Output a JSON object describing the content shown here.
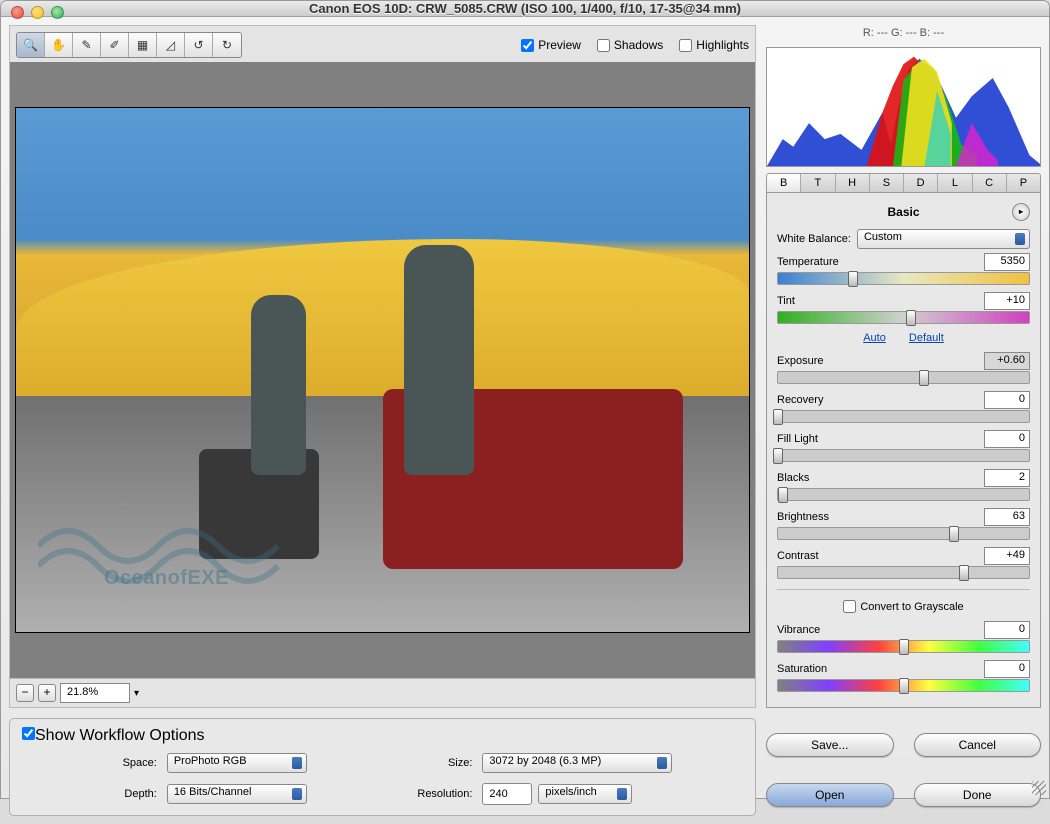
{
  "title": "Canon EOS 10D:  CRW_5085.CRW  (ISO 100, 1/400, f/10, 17-35@34 mm)",
  "toolbar": {
    "preview": "Preview",
    "shadows": "Shadows",
    "highlights": "Highlights"
  },
  "rgb_readout": "R: ---    G: ---    B: ---",
  "tabs": [
    "B",
    "T",
    "H",
    "S",
    "D",
    "L",
    "C",
    "P"
  ],
  "panel_title": "Basic",
  "wb": {
    "label": "White Balance:",
    "value": "Custom"
  },
  "sliders": {
    "temperature": {
      "label": "Temperature",
      "value": "5350",
      "pos": 30
    },
    "tint": {
      "label": "Tint",
      "value": "+10",
      "pos": 53
    },
    "exposure": {
      "label": "Exposure",
      "value": "+0.60",
      "pos": 58
    },
    "recovery": {
      "label": "Recovery",
      "value": "0",
      "pos": 0
    },
    "filllight": {
      "label": "Fill Light",
      "value": "0",
      "pos": 0
    },
    "blacks": {
      "label": "Blacks",
      "value": "2",
      "pos": 2
    },
    "brightness": {
      "label": "Brightness",
      "value": "63",
      "pos": 70
    },
    "contrast": {
      "label": "Contrast",
      "value": "+49",
      "pos": 74
    },
    "vibrance": {
      "label": "Vibrance",
      "value": "0",
      "pos": 50
    },
    "saturation": {
      "label": "Saturation",
      "value": "0",
      "pos": 50
    }
  },
  "links": {
    "auto": "Auto",
    "default": "Default"
  },
  "grayscale": "Convert to Grayscale",
  "zoom": {
    "value": "21.8%"
  },
  "workflow": {
    "legend": "Show Workflow Options",
    "space_label": "Space:",
    "space": "ProPhoto RGB",
    "depth_label": "Depth:",
    "depth": "16 Bits/Channel",
    "size_label": "Size:",
    "size": "3072 by 2048  (6.3 MP)",
    "res_label": "Resolution:",
    "res": "240",
    "res_unit": "pixels/inch"
  },
  "buttons": {
    "save": "Save...",
    "cancel": "Cancel",
    "open": "Open",
    "done": "Done"
  },
  "watermark": "OceanofEXE",
  "icons": {
    "zoom": "🔍",
    "hand": "✋",
    "eyedrop": "✎",
    "eyedrop2": "✐",
    "crop": "▦",
    "straighten": "◿",
    "rotate_ccw": "↺",
    "rotate_cw": "↻"
  }
}
